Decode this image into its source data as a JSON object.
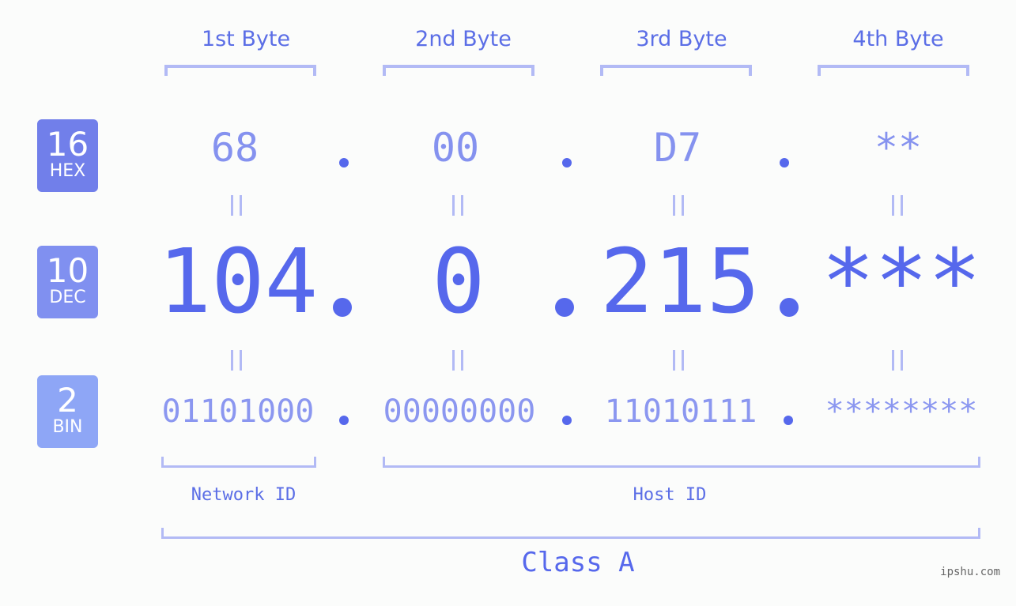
{
  "colors": {
    "hex_badge": "#717fea",
    "dec_badge": "#8090f0",
    "bin_badge": "#8ea6f6",
    "primary": "#5668ec",
    "bracket": "#b2baf5"
  },
  "badges": [
    {
      "num": "16",
      "label": "HEX"
    },
    {
      "num": "10",
      "label": "DEC"
    },
    {
      "num": "2",
      "label": "BIN"
    }
  ],
  "byte_headers": [
    "1st Byte",
    "2nd Byte",
    "3rd Byte",
    "4th Byte"
  ],
  "hex_values": [
    "68",
    "00",
    "D7",
    "**"
  ],
  "dec_values": [
    "104",
    "0",
    "215",
    "***"
  ],
  "bin_values": [
    "01101000",
    "00000000",
    "11010111",
    "********"
  ],
  "network_id_label": "Network ID",
  "host_id_label": "Host ID",
  "class_label": "Class A",
  "watermark": "ipshu.com"
}
